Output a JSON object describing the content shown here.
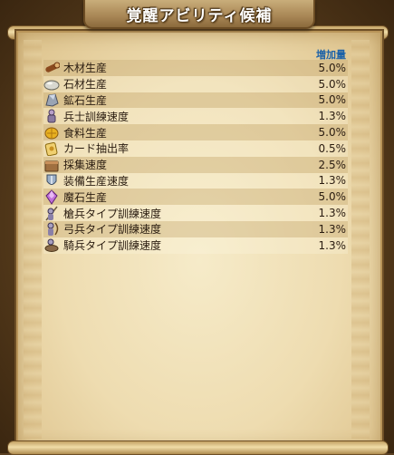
{
  "title": "覚醒アビリティ候補",
  "header": {
    "value_label": "増加量"
  },
  "rows": [
    {
      "label": "木材生産",
      "value": "5.0%",
      "icon": "wood-log-icon"
    },
    {
      "label": "石材生産",
      "value": "5.0%",
      "icon": "stone-icon"
    },
    {
      "label": "鉱石生産",
      "value": "5.0%",
      "icon": "ore-icon"
    },
    {
      "label": "兵士訓練速度",
      "value": "1.3%",
      "icon": "soldier-icon"
    },
    {
      "label": "食料生産",
      "value": "5.0%",
      "icon": "food-icon"
    },
    {
      "label": "カード抽出率",
      "value": "0.5%",
      "icon": "card-icon"
    },
    {
      "label": "採集速度",
      "value": "2.5%",
      "icon": "gathering-icon"
    },
    {
      "label": "装備生産速度",
      "value": "1.3%",
      "icon": "equipment-icon"
    },
    {
      "label": "魔石生産",
      "value": "5.0%",
      "icon": "magic-stone-icon"
    },
    {
      "label": "槍兵タイプ訓練速度",
      "value": "1.3%",
      "icon": "spearman-icon"
    },
    {
      "label": "弓兵タイプ訓練速度",
      "value": "1.3%",
      "icon": "archer-icon"
    },
    {
      "label": "騎兵タイプ訓練速度",
      "value": "1.3%",
      "icon": "cavalry-icon"
    }
  ]
}
